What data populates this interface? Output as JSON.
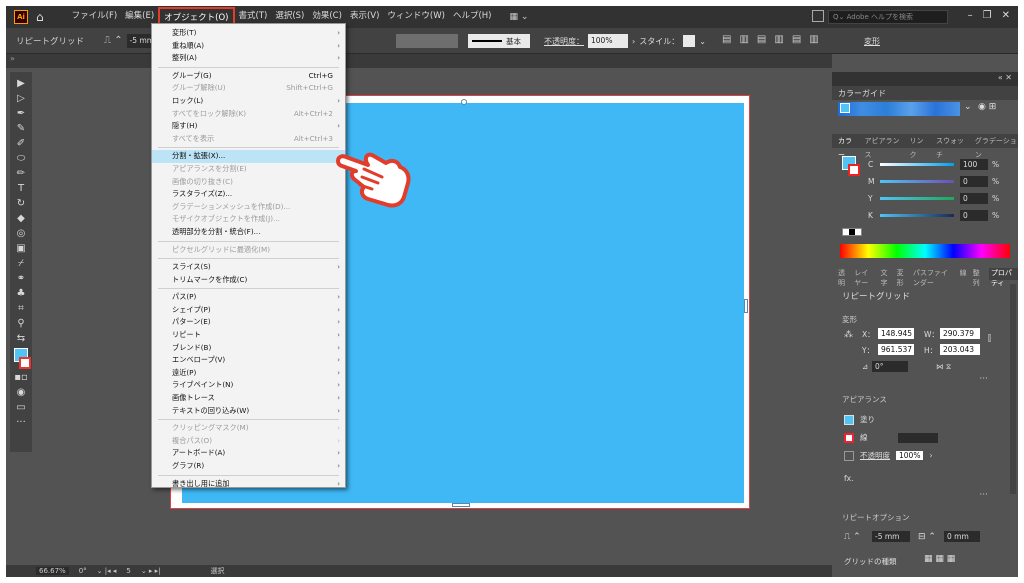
{
  "menubar": {
    "logo": "Ai",
    "items": [
      "ファイル(F)",
      "編集(E)",
      "オブジェクト(O)",
      "書式(T)",
      "選択(S)",
      "効果(C)",
      "表示(V)",
      "ウィンドウ(W)",
      "ヘルプ(H)"
    ],
    "help_placeholder": "Adobe ヘルプを検索"
  },
  "controlbar": {
    "selection_title": "リピートグリッド",
    "spacing_value": "-5 mm",
    "stroke_label": "基本",
    "opacity_label": "不透明度：",
    "opacity_value": "100%",
    "style_label": "スタイル：",
    "transform_label": "変形"
  },
  "object_menu": {
    "items": [
      {
        "label": "変形(T)",
        "shortcut": "",
        "submenu": true,
        "disabled": false
      },
      {
        "label": "重ね順(A)",
        "shortcut": "",
        "submenu": true,
        "disabled": false
      },
      {
        "label": "整列(A)",
        "shortcut": "",
        "submenu": true,
        "disabled": false
      },
      {
        "sep": true
      },
      {
        "label": "グループ(G)",
        "shortcut": "Ctrl+G",
        "submenu": false,
        "disabled": false
      },
      {
        "label": "グループ解除(U)",
        "shortcut": "Shift+Ctrl+G",
        "submenu": false,
        "disabled": true
      },
      {
        "label": "ロック(L)",
        "shortcut": "",
        "submenu": true,
        "disabled": false
      },
      {
        "label": "すべてをロック解除(K)",
        "shortcut": "Alt+Ctrl+2",
        "submenu": false,
        "disabled": true
      },
      {
        "label": "隠す(H)",
        "shortcut": "",
        "submenu": true,
        "disabled": false
      },
      {
        "label": "すべてを表示",
        "shortcut": "Alt+Ctrl+3",
        "submenu": false,
        "disabled": true
      },
      {
        "sep": true
      },
      {
        "label": "分割・拡張(X)...",
        "shortcut": "",
        "submenu": false,
        "disabled": false,
        "highlighted": true
      },
      {
        "label": "アピアランスを分割(E)",
        "shortcut": "",
        "submenu": false,
        "disabled": true
      },
      {
        "label": "画像の切り抜き(C)",
        "shortcut": "",
        "submenu": false,
        "disabled": true
      },
      {
        "label": "ラスタライズ(Z)...",
        "shortcut": "",
        "submenu": false,
        "disabled": false
      },
      {
        "label": "グラデーションメッシュを作成(D)...",
        "shortcut": "",
        "submenu": false,
        "disabled": true
      },
      {
        "label": "モザイクオブジェクトを作成(J)...",
        "shortcut": "",
        "submenu": false,
        "disabled": true
      },
      {
        "label": "透明部分を分割・統合(F)...",
        "shortcut": "",
        "submenu": false,
        "disabled": false
      },
      {
        "sep": true
      },
      {
        "label": "ピクセルグリッドに最適化(M)",
        "shortcut": "",
        "submenu": false,
        "disabled": true
      },
      {
        "sep": true
      },
      {
        "label": "スライス(S)",
        "shortcut": "",
        "submenu": true,
        "disabled": false
      },
      {
        "label": "トリムマークを作成(C)",
        "shortcut": "",
        "submenu": false,
        "disabled": false
      },
      {
        "sep": true
      },
      {
        "label": "パス(P)",
        "shortcut": "",
        "submenu": true,
        "disabled": false
      },
      {
        "label": "シェイプ(P)",
        "shortcut": "",
        "submenu": true,
        "disabled": false
      },
      {
        "label": "パターン(E)",
        "shortcut": "",
        "submenu": true,
        "disabled": false
      },
      {
        "label": "リピート",
        "shortcut": "",
        "submenu": true,
        "disabled": false
      },
      {
        "label": "ブレンド(B)",
        "shortcut": "",
        "submenu": true,
        "disabled": false
      },
      {
        "label": "エンベロープ(V)",
        "shortcut": "",
        "submenu": true,
        "disabled": false
      },
      {
        "label": "遠近(P)",
        "shortcut": "",
        "submenu": true,
        "disabled": false
      },
      {
        "label": "ライブペイント(N)",
        "shortcut": "",
        "submenu": true,
        "disabled": false
      },
      {
        "label": "画像トレース",
        "shortcut": "",
        "submenu": true,
        "disabled": false
      },
      {
        "label": "テキストの回り込み(W)",
        "shortcut": "",
        "submenu": true,
        "disabled": false
      },
      {
        "sep": true
      },
      {
        "label": "クリッピングマスク(M)",
        "shortcut": "",
        "submenu": true,
        "disabled": true
      },
      {
        "label": "複合パス(O)",
        "shortcut": "",
        "submenu": true,
        "disabled": true
      },
      {
        "label": "アートボード(A)",
        "shortcut": "",
        "submenu": true,
        "disabled": false
      },
      {
        "label": "グラフ(R)",
        "shortcut": "",
        "submenu": true,
        "disabled": false
      },
      {
        "sep": true
      },
      {
        "label": "書き出し用に追加",
        "shortcut": "",
        "submenu": true,
        "disabled": false
      }
    ]
  },
  "color_guide": {
    "title": "カラーガイド"
  },
  "color_panel": {
    "tabs": [
      "カラー",
      "アピアランス",
      "リンク",
      "スウォッチ",
      "グラデーション"
    ],
    "channels": [
      {
        "label": "C",
        "value": "100",
        "color": "#00a0e9"
      },
      {
        "label": "M",
        "value": "0",
        "color": "#e4007f"
      },
      {
        "label": "Y",
        "value": "0",
        "color": "#ffe100"
      },
      {
        "label": "K",
        "value": "0",
        "color": "#231815"
      }
    ],
    "unit": "%"
  },
  "properties": {
    "tabs": [
      "透明",
      "レイヤー",
      "文字",
      "変形",
      "パスファインダー",
      "線",
      "整列",
      "プロパティ"
    ],
    "active_tab": "プロパティ",
    "selection": "リピートグリッド",
    "transform_title": "変形",
    "x_label": "X：",
    "x_value": "148.945",
    "y_label": "Y：",
    "y_value": "961.537",
    "w_label": "W：",
    "w_value": "290.379",
    "h_label": "H：",
    "h_value": "203.043",
    "angle_value": "0°",
    "appearance_title": "アピアランス",
    "fill_label": "塗り",
    "stroke_label": "線",
    "opacity_label": "不透明度",
    "opacity_value": "100%",
    "fx_label": "fx.",
    "repeat_title": "リピートオプション",
    "h_spacing": "-5 mm",
    "v_spacing": "0 mm",
    "grid_type_label": "グリッドの種類"
  },
  "statusbar": {
    "zoom": "66.67%",
    "rotation": "0°",
    "page": "5",
    "mode": "選択"
  }
}
